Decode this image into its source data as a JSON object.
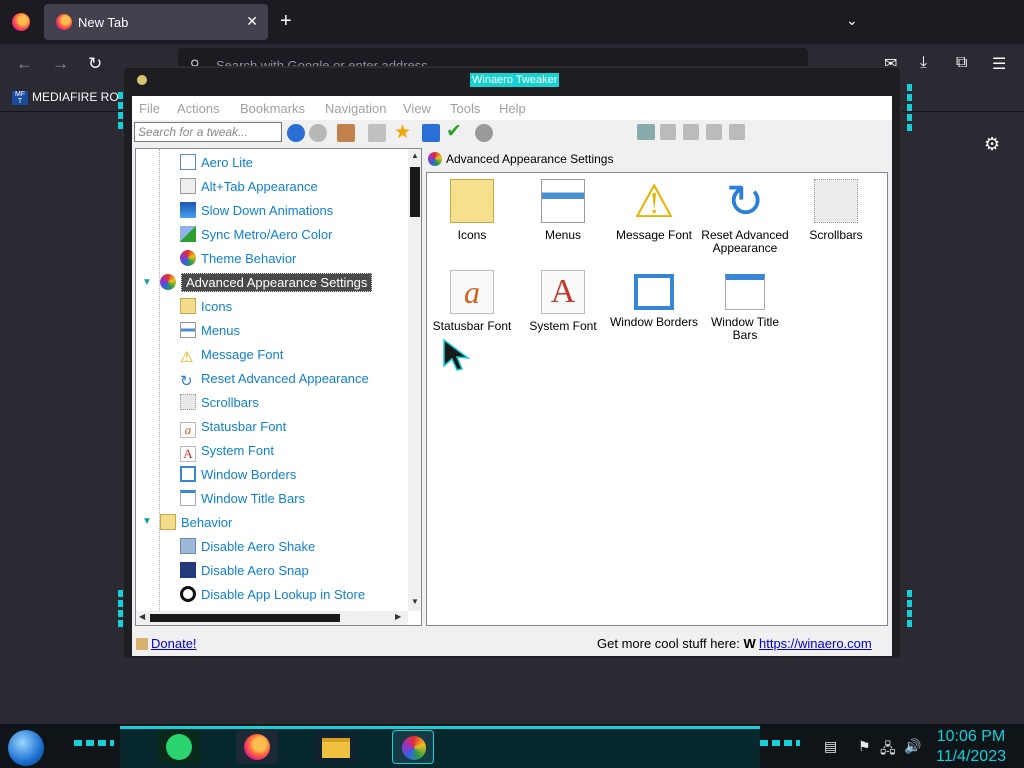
{
  "browser": {
    "tab_title": "New Tab",
    "tab_close": "✕",
    "new_tab": "+",
    "tab_list": "⌄",
    "url_placeholder": "Search with Google or enter address",
    "bookmark": "MEDIAFIRE RO",
    "bookmark_icon_text": "MF T"
  },
  "app": {
    "title": "Winaero Tweaker",
    "menu": [
      "File",
      "Actions",
      "Bookmarks",
      "Navigation",
      "View",
      "Tools",
      "Help"
    ],
    "search_placeholder": "Search for a tweak...",
    "tree": [
      {
        "label": "Aero Lite",
        "icon": "window-icon"
      },
      {
        "label": "Alt+Tab Appearance",
        "icon": "alttab-icon"
      },
      {
        "label": "Slow Down Animations",
        "icon": "monitor-icon"
      },
      {
        "label": "Sync Metro/Aero Color",
        "icon": "color-sync-icon"
      },
      {
        "label": "Theme Behavior",
        "icon": "palette-icon"
      },
      {
        "label": "Advanced Appearance Settings",
        "icon": "palette-icon",
        "selected": true
      },
      {
        "label": "Icons",
        "icon": "icons-icon"
      },
      {
        "label": "Menus",
        "icon": "menus-icon"
      },
      {
        "label": "Message Font",
        "icon": "warning-icon"
      },
      {
        "label": "Reset Advanced Appearance",
        "icon": "reset-icon"
      },
      {
        "label": "Scrollbars",
        "icon": "scrollbars-icon"
      },
      {
        "label": "Statusbar Font",
        "icon": "statusbar-font-icon"
      },
      {
        "label": "System Font",
        "icon": "system-font-icon"
      },
      {
        "label": "Window Borders",
        "icon": "window-borders-icon"
      },
      {
        "label": "Window Title Bars",
        "icon": "window-titlebars-icon"
      },
      {
        "label": "Behavior",
        "icon": "behavior-icon"
      },
      {
        "label": "Disable Aero Shake",
        "icon": "shake-icon"
      },
      {
        "label": "Disable Aero Snap",
        "icon": "snap-icon"
      },
      {
        "label": "Disable App Lookup in Store",
        "icon": "store-icon"
      }
    ],
    "content_title": "Advanced Appearance Settings",
    "items": [
      {
        "label": "Icons"
      },
      {
        "label": "Menus"
      },
      {
        "label": "Message Font"
      },
      {
        "label": "Reset Advanced Appearance"
      },
      {
        "label": "Scrollbars"
      },
      {
        "label": "Statusbar Font"
      },
      {
        "label": "System Font"
      },
      {
        "label": "Window Borders"
      },
      {
        "label": "Window Title Bars"
      }
    ],
    "donate": "Donate!",
    "get_more": "Get more cool stuff here:",
    "winaero_w": "W",
    "link": "https://winaero.com"
  },
  "taskbar": {
    "time": "10:06 PM",
    "date": "11/4/2023"
  },
  "colors": {
    "accent_cyan": "#15d0d9",
    "link_blue": "#0000cc",
    "tree_text": "#1080d0"
  }
}
